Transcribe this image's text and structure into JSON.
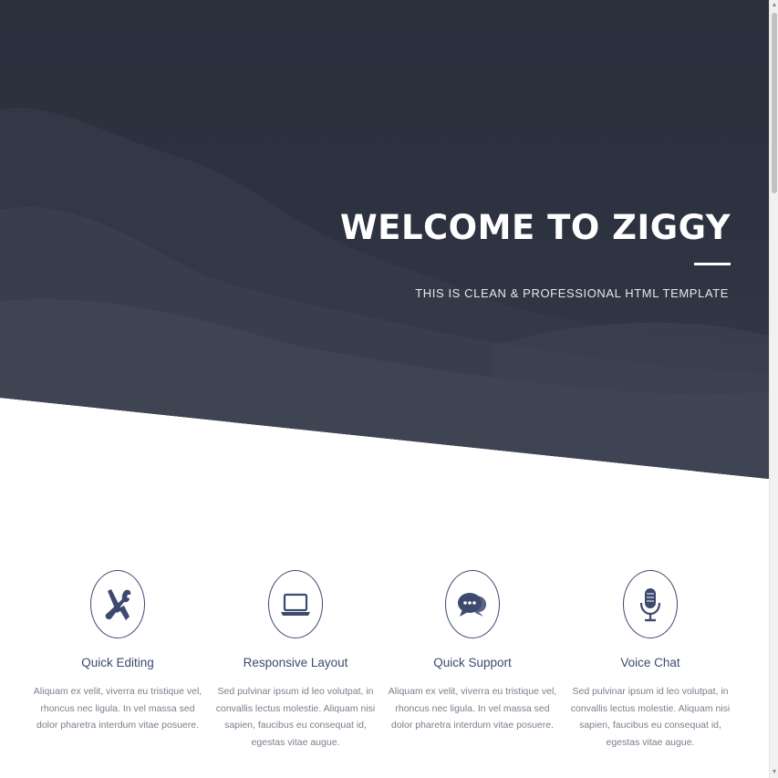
{
  "hero": {
    "title": "WELCOME TO ZIGGY",
    "subtitle": "THIS IS CLEAN & PROFESSIONAL HTML TEMPLATE"
  },
  "features": [
    {
      "icon": "tools-icon",
      "title": "Quick Editing",
      "text": "Aliquam ex velit, viverra eu tristique vel, rhoncus nec ligula. In vel massa sed dolor pharetra interdum vitae posuere."
    },
    {
      "icon": "laptop-icon",
      "title": "Responsive Layout",
      "text": "Sed pulvinar ipsum id leo volutpat, in convallis lectus molestie. Aliquam nisi sapien, faucibus eu consequat id, egestas vitae augue."
    },
    {
      "icon": "chat-icon",
      "title": "Quick Support",
      "text": "Aliquam ex velit, viverra eu tristique vel, rhoncus nec ligula. In vel massa sed dolor pharetra interdum vitae posuere."
    },
    {
      "icon": "microphone-icon",
      "title": "Voice Chat",
      "text": "Sed pulvinar ipsum id leo volutpat, in convallis lectus molestie. Aliquam nisi sapien, faucibus eu consequat id, egestas vitae augue."
    }
  ],
  "colors": {
    "hero_background": "#2d3240",
    "accent": "#3d4a6e",
    "body_text": "#7a7f8c"
  }
}
